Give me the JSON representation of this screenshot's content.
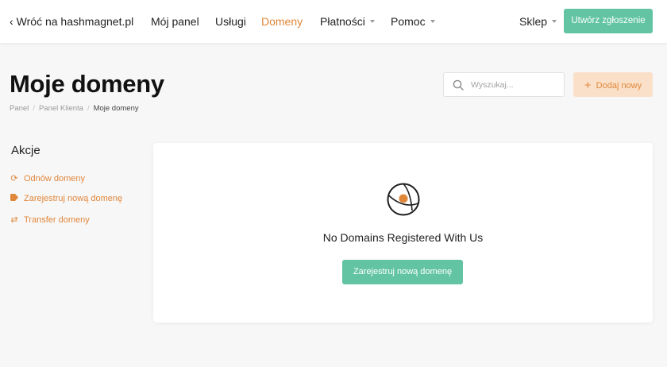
{
  "topnav": {
    "back_link": "Wróć na hashmagnet.pl",
    "items": [
      {
        "label": "Mój panel"
      },
      {
        "label": "Usługi"
      },
      {
        "label": "Domeny"
      },
      {
        "label": "Płatności"
      },
      {
        "label": "Pomoc"
      }
    ],
    "shop_label": "Sklep",
    "ticket_button": "Utwórz zgłoszenie",
    "active_item": "Domeny"
  },
  "header": {
    "title": "Moje domeny",
    "breadcrumb": [
      "Panel",
      "Panel Klienta",
      "Moje domeny"
    ]
  },
  "search": {
    "placeholder": "Wyszukaj...",
    "value": ""
  },
  "add_button": "Dodaj nowy",
  "sidebar": {
    "title": "Akcje",
    "items": [
      {
        "label": "Odnów domeny",
        "icon": "refresh-icon"
      },
      {
        "label": "Zarejestruj nową domenę",
        "icon": "tag-icon"
      },
      {
        "label": "Transfer domeny",
        "icon": "exchange-icon"
      }
    ]
  },
  "empty_state": {
    "message": "No Domains Registered With Us",
    "button": "Zarejestruj nową domenę",
    "icon": "globe-icon"
  },
  "colors": {
    "accent": "#e0873a",
    "primary_button": "#62c4a3",
    "add_button_bg": "#fbe0c9"
  }
}
